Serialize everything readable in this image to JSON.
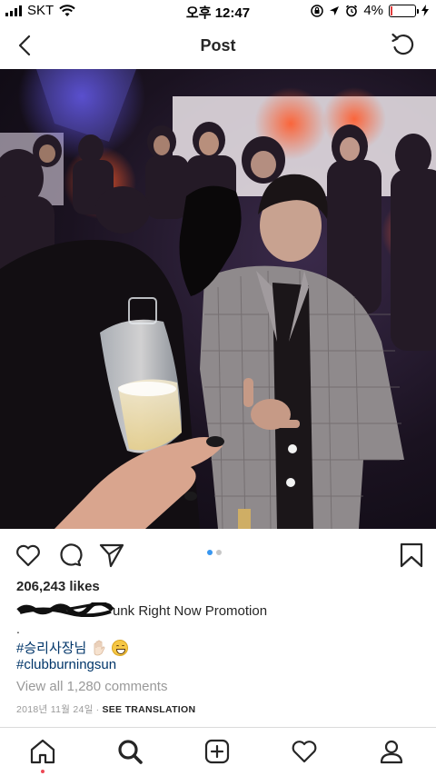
{
  "status_bar": {
    "carrier": "SKT",
    "time": "오후 12:47",
    "battery_percent": "4%"
  },
  "nav": {
    "title": "Post"
  },
  "post": {
    "carousel": {
      "total": 2,
      "current": 1
    },
    "likes": "206,243 likes",
    "caption_text": "unk Right Now Promotion",
    "caption_dot": ".",
    "hashtag_1": "#승리사장님",
    "hashtag_2": "#clubburningsun",
    "view_comments": "View all 1,280 comments",
    "date": "2018년 11월 24일",
    "separator": "·",
    "see_translation": "SEE TRANSLATION"
  },
  "icons": {
    "back": "back-arrow-icon",
    "refresh": "refresh-icon",
    "like": "heart-icon",
    "comment": "comment-icon",
    "share": "share-icon",
    "save": "bookmark-icon",
    "home": "home-icon",
    "search": "search-icon",
    "add": "add-post-icon",
    "activity": "heart-icon",
    "profile": "profile-icon"
  },
  "colors": {
    "hashtag": "#003569",
    "muted": "#999999",
    "carousel_active": "#3897f0",
    "notification_dot": "#ed4956"
  }
}
